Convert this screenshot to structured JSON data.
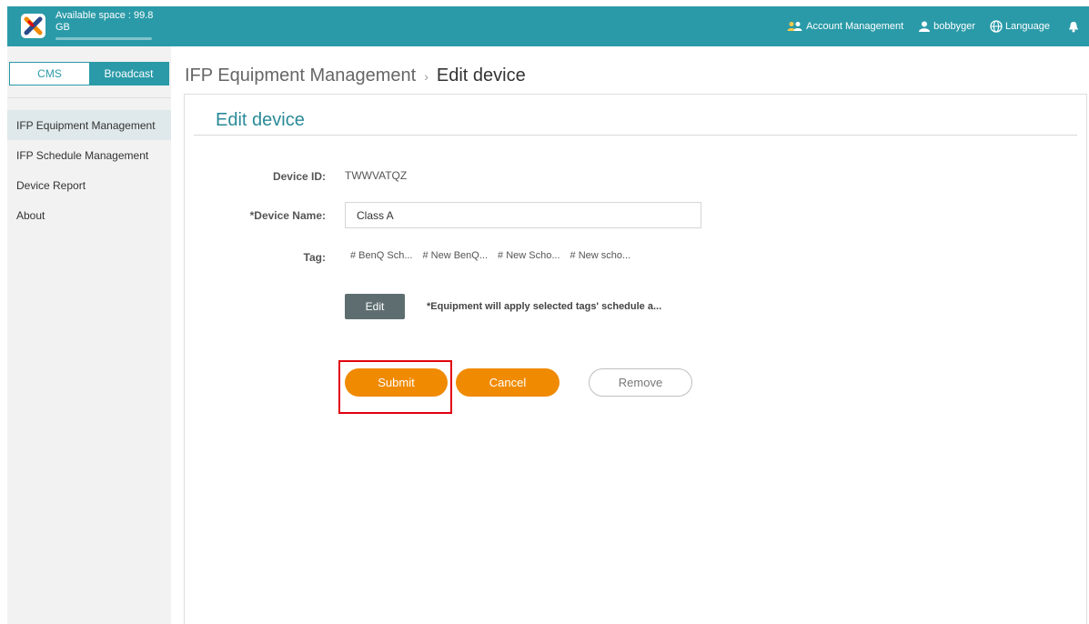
{
  "header": {
    "available_space": "Available space : 99.8 GB",
    "account_management": "Account Management",
    "username": "bobbyger",
    "language": "Language",
    "storage_used_fraction": 0.95
  },
  "sidebar": {
    "segment": {
      "cms": "CMS",
      "broadcast": "Broadcast",
      "selected": "Broadcast"
    },
    "items": [
      {
        "label": "IFP Equipment Management",
        "selected": true
      },
      {
        "label": "IFP Schedule Management",
        "selected": false
      },
      {
        "label": "Device Report",
        "selected": false
      },
      {
        "label": "About",
        "selected": false
      }
    ]
  },
  "breadcrumb": {
    "parent": "IFP Equipment Management",
    "separator": "›",
    "current": "Edit device"
  },
  "form": {
    "title": "Edit device",
    "device_id_label": "Device ID:",
    "device_id_value": "TWWVATQZ",
    "device_name_label": "*Device Name:",
    "device_name_value": "Class A",
    "tag_label": "Tag:",
    "tags": [
      "# BenQ Sch...",
      "# New BenQ...",
      "# New Scho...",
      "# New scho..."
    ],
    "edit_label": "Edit",
    "note": "*Equipment will apply selected tags' schedule a...",
    "submit_label": "Submit",
    "cancel_label": "Cancel",
    "remove_label": "Remove"
  },
  "colors": {
    "accent": "#2a9aa8",
    "primary_button": "#f08a00",
    "highlight": "#e1000f"
  },
  "icons": [
    "app-logo",
    "account-group-icon",
    "user-icon",
    "globe-icon",
    "bell-icon"
  ]
}
